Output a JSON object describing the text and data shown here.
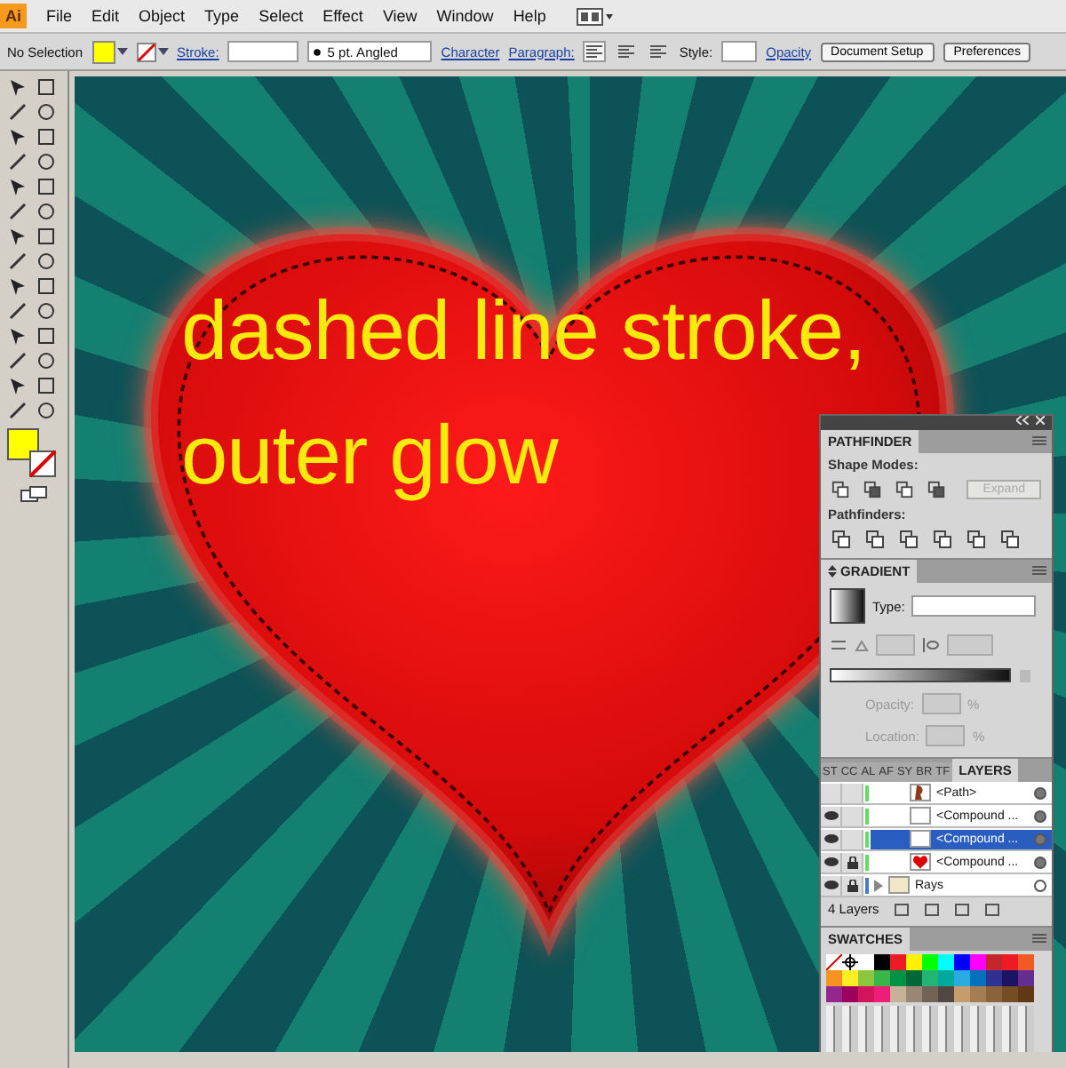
{
  "app": {
    "logo": "Ai",
    "menu": [
      "File",
      "Edit",
      "Object",
      "Type",
      "Select",
      "Effect",
      "View",
      "Window",
      "Help"
    ]
  },
  "control_bar": {
    "selection": "No Selection",
    "fill": {
      "color": "#ffff00"
    },
    "stroke_link": "Stroke:",
    "brush": "5 pt. Angled",
    "character": "Character",
    "paragraph": "Paragraph:",
    "align": [
      {
        "selected": true
      },
      {
        "selected": false
      },
      {
        "selected": false
      }
    ],
    "style_label": "Style:",
    "opacity": "Opacity",
    "buttons": [
      "Document Setup",
      "Preferences"
    ]
  },
  "toolbox": {
    "fill": {
      "color": "#ffff00"
    }
  },
  "artwork": {
    "lines": [
      "dashed line stroke,",
      "outer glow"
    ]
  },
  "pathfinder": {
    "title": "PATHFINDER",
    "shape_modes": "Shape Modes:",
    "expand": "Expand",
    "expand_disabled": true,
    "pathfinders": "Pathfinders:"
  },
  "gradient": {
    "title": "GRADIENT",
    "type_label": "Type:",
    "opacity_label": "Opacity:",
    "location_label": "Location:",
    "percent": "%"
  },
  "layers": {
    "tabs": [
      {
        "label": "ST",
        "selected": false
      },
      {
        "label": "CC",
        "selected": false
      },
      {
        "label": "AL",
        "selected": false
      },
      {
        "label": "AF",
        "selected": false
      },
      {
        "label": "SY",
        "selected": false
      },
      {
        "label": "BR",
        "selected": false
      },
      {
        "label": "TF",
        "selected": false
      },
      {
        "label": "LAYERS",
        "selected": true
      }
    ],
    "rows": [
      {
        "name": "<Path>",
        "visible": false,
        "locked": false,
        "selected": false,
        "color": "#5ee05e",
        "kind": "path"
      },
      {
        "name": "<Compound ...",
        "visible": true,
        "locked": false,
        "selected": false,
        "color": "#5ee05e",
        "kind": "blank"
      },
      {
        "name": "<Compound ...",
        "visible": true,
        "locked": false,
        "selected": true,
        "color": "#5ee05e",
        "kind": "blank"
      },
      {
        "name": "<Compound ...",
        "visible": true,
        "locked": true,
        "selected": false,
        "color": "#5ee05e",
        "kind": "heart"
      },
      {
        "name": "Rays",
        "visible": true,
        "locked": true,
        "selected": false,
        "color": "#4a78d8",
        "kind": "layer"
      }
    ],
    "count": "4 Layers"
  },
  "swatches": {
    "title": "SWATCHES",
    "items": [
      {
        "kind": "none"
      },
      {
        "kind": "registration"
      },
      {
        "kind": "color",
        "color": "#ffffff"
      },
      {
        "kind": "color",
        "color": "#000000"
      },
      {
        "kind": "color",
        "color": "#ed1c24"
      },
      {
        "kind": "color",
        "color": "#fff200"
      },
      {
        "kind": "color",
        "color": "#00ff00"
      },
      {
        "kind": "color",
        "color": "#00ffff"
      },
      {
        "kind": "color",
        "color": "#0000ff"
      },
      {
        "kind": "color",
        "color": "#ff00ff"
      },
      {
        "kind": "color",
        "color": "#c1272d"
      },
      {
        "kind": "color",
        "color": "#ed1c24"
      },
      {
        "kind": "color",
        "color": "#f15a24"
      },
      {
        "kind": "color",
        "color": "#f7931e"
      },
      {
        "kind": "color",
        "color": "#fcee21"
      },
      {
        "kind": "color",
        "color": "#8cc63f"
      },
      {
        "kind": "color",
        "color": "#39b54a"
      },
      {
        "kind": "color",
        "color": "#009245"
      },
      {
        "kind": "color",
        "color": "#006837"
      },
      {
        "kind": "color",
        "color": "#22b573"
      },
      {
        "kind": "color",
        "color": "#00a99d"
      },
      {
        "kind": "color",
        "color": "#29abe2"
      },
      {
        "kind": "color",
        "color": "#0071bc"
      },
      {
        "kind": "color",
        "color": "#2e3192"
      },
      {
        "kind": "color",
        "color": "#1b1464"
      },
      {
        "kind": "color",
        "color": "#662d91"
      },
      {
        "kind": "color",
        "color": "#93278f"
      },
      {
        "kind": "color",
        "color": "#9e005d"
      },
      {
        "kind": "color",
        "color": "#d4145a"
      },
      {
        "kind": "color",
        "color": "#ed1e79"
      },
      {
        "kind": "color",
        "color": "#c7b299"
      },
      {
        "kind": "color",
        "color": "#998675"
      },
      {
        "kind": "color",
        "color": "#736357"
      },
      {
        "kind": "color",
        "color": "#534741"
      },
      {
        "kind": "color",
        "color": "#c69c6d"
      },
      {
        "kind": "color",
        "color": "#a67c52"
      },
      {
        "kind": "color",
        "color": "#8c6239"
      },
      {
        "kind": "color",
        "color": "#754c24"
      },
      {
        "kind": "color",
        "color": "#603813"
      }
    ]
  }
}
